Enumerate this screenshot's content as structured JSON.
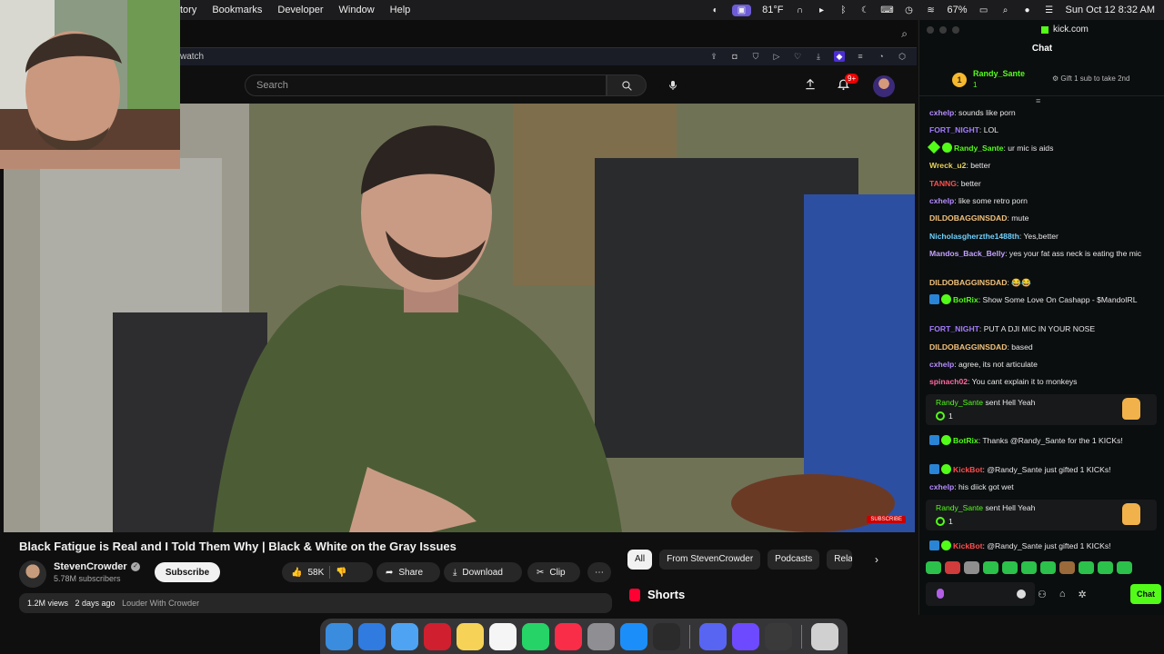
{
  "menubar": {
    "menus": [
      "tory",
      "Bookmarks",
      "Developer",
      "Window",
      "Help"
    ],
    "temperature": "81°F",
    "battery": "67%",
    "datetime": "Sun Oct 12  8:32 AM"
  },
  "browser": {
    "url_fragment": "watch"
  },
  "youtube": {
    "search_placeholder": "Search",
    "notifications_badge": "9+",
    "video_badge": "SUBSCRIBE",
    "title": "Black Fatigue is Real and I Told Them Why | Black & White on the Gray Issues",
    "channel_name": "StevenCrowder",
    "channel_subs": "5.78M subscribers",
    "subscribe_label": "Subscribe",
    "likes": "58K",
    "share_label": "Share",
    "download_label": "Download",
    "clip_label": "Clip",
    "views": "1.2M views",
    "age": "2 days ago",
    "meta_link": "Louder With Crowder",
    "chips": [
      "All",
      "From StevenCrowder",
      "Podcasts",
      "Relat"
    ],
    "shorts_label": "Shorts"
  },
  "chat": {
    "site": "kick.com",
    "heading": "Chat",
    "pinned": {
      "rank": "1",
      "user": "Randy_Sante",
      "count": "1",
      "gift_text": "Gift 1 sub to take 2nd"
    },
    "messages": [
      {
        "user": "cxhelp",
        "color": "#b58cff",
        "text": "sounds like porn"
      },
      {
        "user": "FORT_NIGHT",
        "color": "#a47cff",
        "text": "LOL"
      },
      {
        "user": "Randy_Sante",
        "color": "#53fc18",
        "text": "ur mic is aids",
        "badges": [
          "diamond",
          "verified"
        ]
      },
      {
        "user": "Wreck_u2",
        "color": "#e8d25a",
        "text": "better"
      },
      {
        "user": "TANNG",
        "color": "#ff4d4d",
        "text": "better"
      },
      {
        "user": "cxhelp",
        "color": "#b58cff",
        "text": "like some retro porn"
      },
      {
        "user": "DILDOBAGGINSDAD",
        "color": "#f3c27a",
        "text": "mute"
      },
      {
        "user": "Nicholasgherzthe1488th",
        "color": "#6fd2ff",
        "text": "Yes,better"
      },
      {
        "user": "Mandos_Back_Belly",
        "color": "#c3a0ff",
        "text": "yes your fat ass neck is eating the mic"
      },
      {
        "user": "DILDOBAGGINSDAD",
        "color": "#f3c27a",
        "text": "😂😂"
      },
      {
        "user": "BotRix",
        "color": "#53fc18",
        "text": "Show Some Love On Cashapp - $MandoIRL",
        "badges": [
          "bot",
          "verified"
        ]
      },
      {
        "user": "FORT_NIGHT",
        "color": "#a47cff",
        "text": "PUT A DJI MIC IN YOUR NOSE"
      },
      {
        "user": "DILDOBAGGINSDAD",
        "color": "#f3c27a",
        "text": "based"
      },
      {
        "user": "cxhelp",
        "color": "#b58cff",
        "text": "agree, its not articulate"
      },
      {
        "user": "spinach02",
        "color": "#ff6aa0",
        "text": "You cant explain it to monkeys"
      },
      {
        "user": "BotRix",
        "color": "#53fc18",
        "text": "Thanks @Randy_Sante for the 1 KICKs!",
        "badges": [
          "bot",
          "verified"
        ]
      },
      {
        "user": "KickBot",
        "color": "#ff4d4d",
        "text": "@Randy_Sante just gifted 1 KICKs!",
        "badges": [
          "bot",
          "verified"
        ]
      },
      {
        "user": "cxhelp",
        "color": "#b58cff",
        "text": "his diick got wet"
      },
      {
        "user": "KickBot",
        "color": "#ff4d4d",
        "text": "@Randy_Sante just gifted 1 KICKs!",
        "badges": [
          "bot",
          "verified"
        ]
      }
    ],
    "gift_cards": [
      {
        "user": "Randy_Sante",
        "mid": "sent",
        "item": "Hell Yeah",
        "count": "1"
      },
      {
        "user": "Randy_Sante",
        "mid": "sent",
        "item": "Hell Yeah",
        "count": "1"
      }
    ],
    "send_label": "Chat"
  },
  "dock_apps": [
    {
      "name": "finder",
      "color": "#3a8dde"
    },
    {
      "name": "safari",
      "color": "#2f7be0"
    },
    {
      "name": "mail",
      "color": "#4ea4f2"
    },
    {
      "name": "opera",
      "color": "#d01f2e"
    },
    {
      "name": "notes",
      "color": "#f6d357"
    },
    {
      "name": "reminders",
      "color": "#f5f5f5"
    },
    {
      "name": "whatsapp",
      "color": "#25d366"
    },
    {
      "name": "music",
      "color": "#fa2d48"
    },
    {
      "name": "system-settings",
      "color": "#8e8e93"
    },
    {
      "name": "app-store",
      "color": "#1c8ef9"
    },
    {
      "name": "obs",
      "color": "#2b2b2b"
    },
    {
      "name": "discord",
      "color": "#5865f2"
    },
    {
      "name": "proton-mail",
      "color": "#6d4aff"
    },
    {
      "name": "chatgpt",
      "color": "#3a3a3a"
    },
    {
      "name": "trash",
      "color": "#d0d0d0"
    }
  ]
}
